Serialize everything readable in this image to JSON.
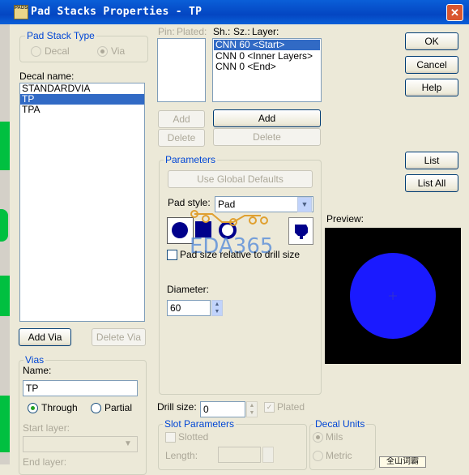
{
  "window": {
    "title": "Pad Stacks Properties - TP",
    "icon_text": "PADS"
  },
  "colors": {
    "titlebar": "#0a5fd8",
    "preview_bg": "#000000",
    "pad_fill": "#1a1aff",
    "selection": "#316ac5",
    "accent_green": "#00c040"
  },
  "pad_stack_type": {
    "group_label": "Pad Stack Type",
    "options": [
      {
        "label": "Decal",
        "selected": false
      },
      {
        "label": "Via",
        "selected": true
      }
    ]
  },
  "decal": {
    "label": "Decal name:",
    "items": [
      {
        "label": "STANDARDVIA",
        "selected": false
      },
      {
        "label": "TP",
        "selected": true
      },
      {
        "label": "TPA",
        "selected": false
      }
    ]
  },
  "pins": {
    "header_pin": "Pin:",
    "header_plated": "Plated:"
  },
  "layers": {
    "header_sh": "Sh.:",
    "header_sz": "Sz.:",
    "header_layer": "Layer:",
    "items": [
      {
        "label": "CNN 60 <Start>",
        "selected": true
      },
      {
        "label": "CNN 0 <Inner Layers>",
        "selected": false
      },
      {
        "label": "CNN 0 <End>",
        "selected": false
      }
    ]
  },
  "buttons": {
    "ok": "OK",
    "cancel": "Cancel",
    "help": "Help",
    "list": "List",
    "list_all": "List All",
    "pin_add": "Add",
    "pin_delete": "Delete",
    "layer_add": "Add",
    "layer_delete": "Delete",
    "add_via": "Add Via",
    "delete_via": "Delete Via"
  },
  "parameters": {
    "group_label": "Parameters",
    "use_global": "Use Global Defaults",
    "pad_style_label": "Pad style:",
    "pad_style_value": "Pad",
    "relative_label": "Pad size relative to drill size",
    "diameter_label": "Diameter:",
    "diameter_value": "60"
  },
  "preview": {
    "label": "Preview:"
  },
  "watermark": {
    "text": "EDA365"
  },
  "vias": {
    "group_label": "Vias",
    "name_label": "Name:",
    "name_value": "TP",
    "through": "Through",
    "partial": "Partial",
    "start_layer": "Start layer:",
    "end_layer": "End layer:"
  },
  "drill": {
    "label": "Drill size:",
    "value": "0",
    "plated": "Plated"
  },
  "slot": {
    "group_label": "Slot Parameters",
    "slotted": "Slotted",
    "length": "Length:"
  },
  "decal_units": {
    "group_label": "Decal Units",
    "mils": "Mils",
    "metric": "Metric"
  },
  "corner_text": "全山词霸"
}
